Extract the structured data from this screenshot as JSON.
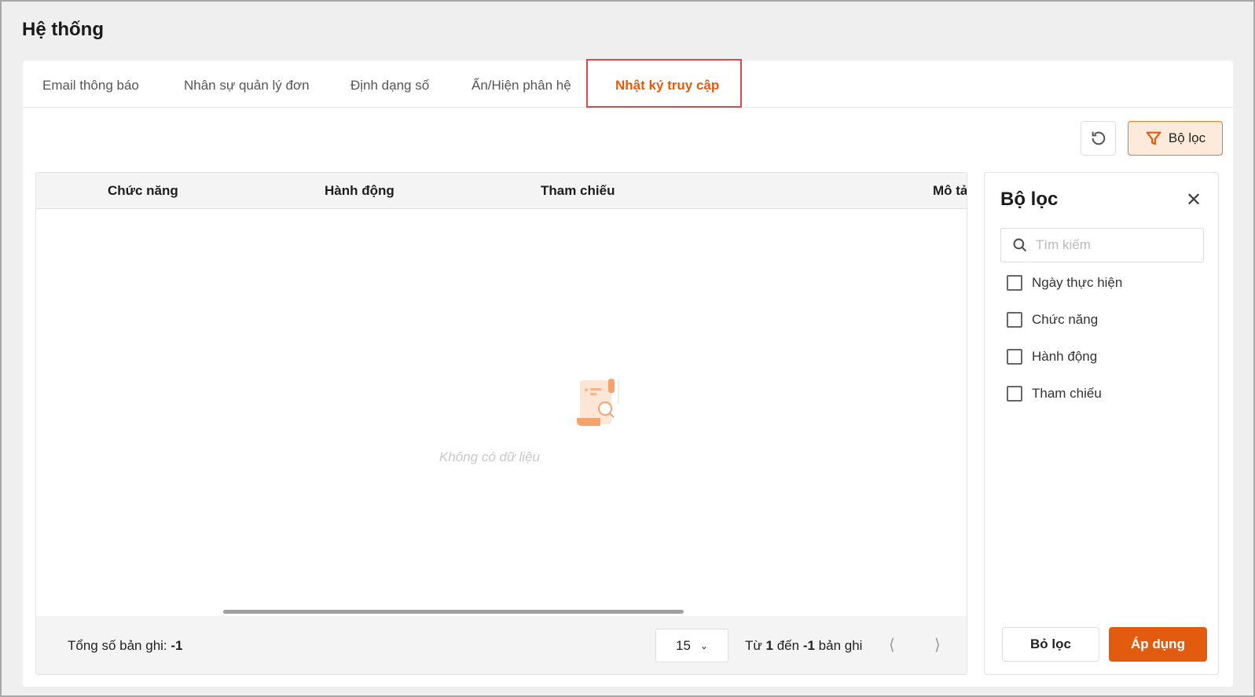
{
  "page": {
    "title": "Hệ thống"
  },
  "tabs": [
    {
      "label": "Email thông báo"
    },
    {
      "label": "Nhân sự quản lý đơn"
    },
    {
      "label": "Định dạng số"
    },
    {
      "label": "Ẩn/Hiện phân hệ"
    },
    {
      "label": "Nhật ký truy cập",
      "active": true
    }
  ],
  "toolbar": {
    "reset_icon": "refresh-icon",
    "filter_label": "Bộ lọc"
  },
  "table": {
    "columns": [
      "Chức năng",
      "Hành động",
      "Tham chiếu",
      "Mô tả"
    ],
    "empty_text": "Không có dữ liệu"
  },
  "footer": {
    "total_label": "Tổng số bản ghi:",
    "total_value": "-1",
    "page_size": "15",
    "range_prefix": "Từ",
    "range_from": "1",
    "range_mid": "đến",
    "range_to": "-1",
    "range_suffix": "bản ghi"
  },
  "filter_panel": {
    "title": "Bộ lọc",
    "search_placeholder": "Tìm kiếm",
    "options": [
      "Ngày thực hiện",
      "Chức năng",
      "Hành động",
      "Tham chiếu"
    ],
    "clear_label": "Bỏ lọc",
    "apply_label": "Áp dụng"
  },
  "colors": {
    "accent": "#e25b0e",
    "highlight_box": "#e0474c"
  }
}
